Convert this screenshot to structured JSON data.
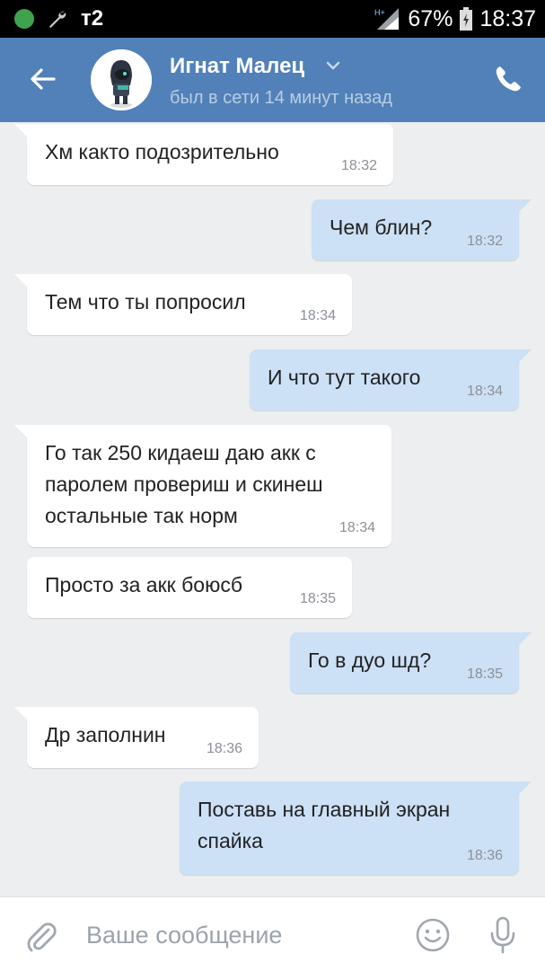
{
  "status_bar": {
    "carrier": "т2",
    "battery": "67%",
    "time": "18:37",
    "network": "H+",
    "icons": [
      "shield-icon",
      "wrench-icon",
      "signal-icon",
      "battery-icon"
    ]
  },
  "header": {
    "contact_name": "Игнат Малец",
    "contact_status": "был в сети 14 минут назад",
    "icons": [
      "back-arrow-icon",
      "chevron-down-icon",
      "phone-icon"
    ],
    "accent_color": "#5181b8"
  },
  "messages": [
    {
      "direction": "in",
      "text": "Хм както подозрительно",
      "time": "18:32"
    },
    {
      "direction": "out",
      "text": "Чем блин?",
      "time": "18:32"
    },
    {
      "direction": "in",
      "text": "Тем что ты попросил",
      "time": "18:34"
    },
    {
      "direction": "out",
      "text": "И что тут такого",
      "time": "18:34"
    },
    {
      "direction": "in",
      "text": "Го так 250 кидаеш даю акк с паролем провериш и скинеш остальные так норм",
      "time": "18:34"
    },
    {
      "direction": "in",
      "text": "Просто за акк боюсб",
      "time": "18:35"
    },
    {
      "direction": "out",
      "text": "Го в дуо шд?",
      "time": "18:35"
    },
    {
      "direction": "in",
      "text": "Др заполнин",
      "time": "18:36"
    },
    {
      "direction": "out",
      "text": "Поставь на главный экран спайка",
      "time": "18:36"
    }
  ],
  "composer": {
    "placeholder": "Ваше сообщение",
    "icons": [
      "paperclip-icon",
      "smile-icon",
      "microphone-icon"
    ]
  }
}
